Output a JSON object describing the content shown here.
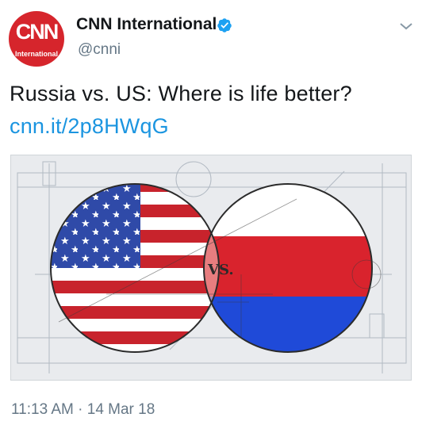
{
  "tweet": {
    "avatar_logo": "CNN",
    "avatar_sub": "International",
    "display_name": "CNN International",
    "handle": "@cnni",
    "text": "Russia vs. US: Where is life better?",
    "link": "cnn.it/2p8HWqG",
    "card_image_label": "VS.",
    "timestamp": "11:13 AM · 14 Mar 18"
  },
  "colors": {
    "brand_red": "#d6252c",
    "verified_blue": "#1da1f2",
    "link_blue": "#1b95e0",
    "text_secondary": "#657786",
    "us_red": "#c8232c",
    "us_blue": "#2f4aa8",
    "ru_blue": "#1f4ad8"
  },
  "icons": [
    "verified-badge-icon",
    "chevron-down-icon"
  ]
}
